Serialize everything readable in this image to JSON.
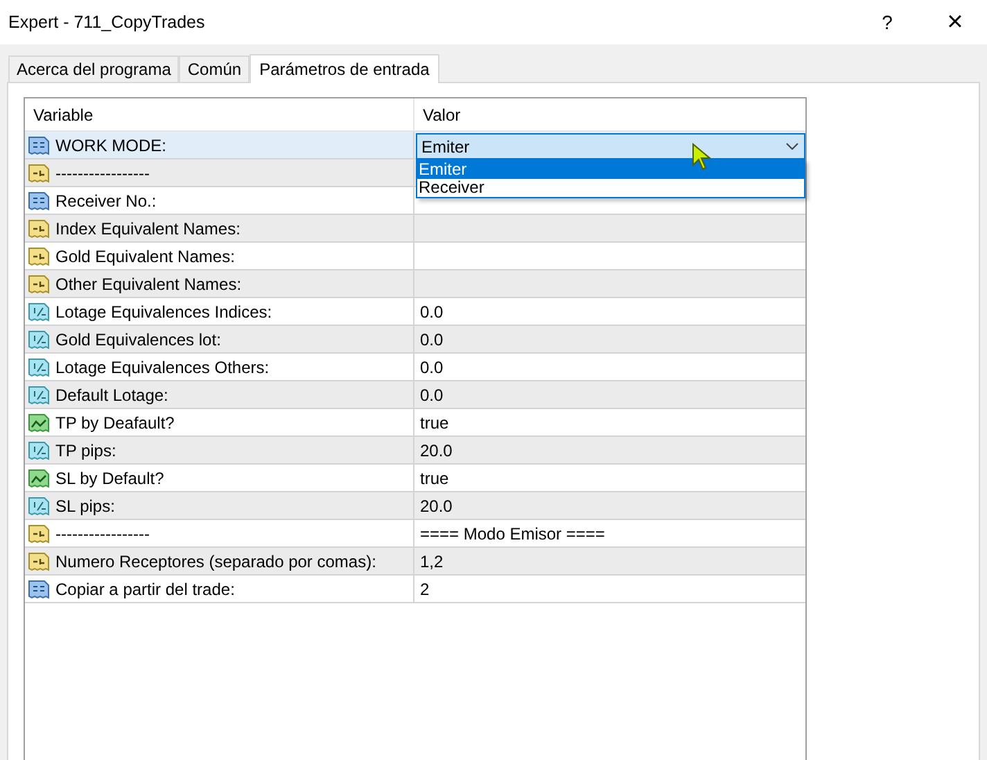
{
  "window": {
    "title": "Expert - 711_CopyTrades",
    "help_button": "?",
    "close_button": "×"
  },
  "tabs": [
    {
      "label": "Acerca del programa",
      "selected": false
    },
    {
      "label": "Común",
      "selected": false
    },
    {
      "label": "Parámetros de entrada",
      "selected": true
    }
  ],
  "table": {
    "columns": [
      "Variable",
      "Valor"
    ],
    "rows": [
      {
        "kind": "int",
        "variable": "WORK MODE:",
        "selected": true
      },
      {
        "kind": "string",
        "variable": "-----------------",
        "selected": false
      },
      {
        "kind": "int",
        "variable": "Receiver No.:",
        "selected": false
      },
      {
        "kind": "string",
        "variable": "Index Equivalent Names:",
        "selected": false
      },
      {
        "kind": "string",
        "variable": "Gold Equivalent Names:",
        "selected": false
      },
      {
        "kind": "string",
        "variable": "Other Equivalent Names:",
        "selected": false
      },
      {
        "kind": "double",
        "variable": "Lotage Equivalences Indices:",
        "value": "0.0",
        "selected": false
      },
      {
        "kind": "double",
        "variable": "Gold Equivalences lot:",
        "value": "0.0",
        "selected": false
      },
      {
        "kind": "double",
        "variable": "Lotage Equivalences Others:",
        "value": "0.0",
        "selected": false
      },
      {
        "kind": "double",
        "variable": "Default Lotage:",
        "value": "0.0",
        "selected": false
      },
      {
        "kind": "bool",
        "variable": "TP by Deafault?",
        "value": "true",
        "selected": false
      },
      {
        "kind": "double",
        "variable": "TP pips:",
        "value": "20.0",
        "selected": false
      },
      {
        "kind": "bool",
        "variable": "SL by Default?",
        "value": "true",
        "selected": false
      },
      {
        "kind": "double",
        "variable": "SL pips:",
        "value": "20.0",
        "selected": false
      },
      {
        "kind": "string",
        "variable": "-----------------",
        "value": "==== Modo Emisor ====",
        "selected": false
      },
      {
        "kind": "string",
        "variable": "Numero Receptores (separado por comas):",
        "value": "1,2",
        "selected": false
      },
      {
        "kind": "int",
        "variable": "Copiar a partir del trade:",
        "value": "2",
        "selected": false
      }
    ]
  },
  "dropdown": {
    "value": "Emiter",
    "options": [
      {
        "label": "Emiter",
        "selected": true
      },
      {
        "label": "Receiver",
        "selected": false
      }
    ]
  }
}
